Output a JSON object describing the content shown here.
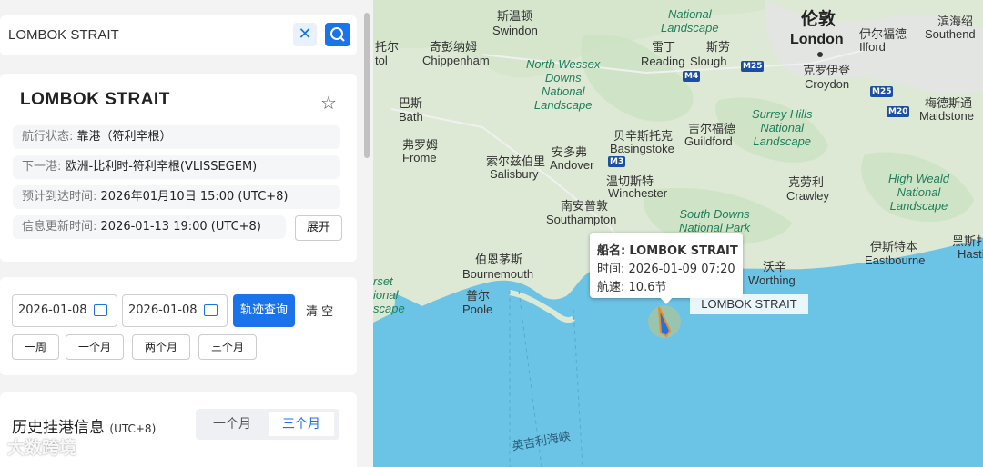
{
  "search": {
    "query": "LOMBOK STRAIT",
    "clear_icon": "close-icon",
    "search_icon": "search-icon"
  },
  "ship": {
    "name": "LOMBOK STRAIT",
    "status_label": "航行状态:",
    "status_value": "靠港（符利辛根）",
    "next_port_label": "下一港:",
    "next_port_value": "欧洲-比利时-符利辛根(VLISSEGEM)",
    "eta_label": "预计到达时间:",
    "eta_value": "2026年01月10日 15:00 (UTC+8)",
    "updated_label": "信息更新时间:",
    "updated_value": "2026-01-13 19:00 (UTC+8)",
    "expand_label": "展开"
  },
  "track": {
    "start_date": "2026-01-08",
    "end_date": "2026-01-08",
    "query_label": "轨迹查询",
    "clear_label": "清 空",
    "quick": [
      "一周",
      "一个月",
      "两个月",
      "三个月"
    ]
  },
  "history": {
    "title": "历史挂港信息",
    "tz": "(UTC+8)",
    "tab_one_month": "一个月",
    "tab_three_months": "三个月"
  },
  "watermark": "大数跨境",
  "map": {
    "labels": {
      "swindon_cn": "斯温顿",
      "swindon": "Swindon",
      "chippenham_cn": "奇彭纳姆",
      "chippenham": "Chippenham",
      "tuoer_cn": "托尔",
      "tol": "tol",
      "bath_cn": "巴斯",
      "bath": "Bath",
      "frome_cn": "弗罗姆",
      "frome": "Frome",
      "reading_cn": "雷丁",
      "reading": "Reading",
      "slough_cn": "斯劳",
      "slough": "Slough",
      "london_cn": "伦敦",
      "london": "London",
      "ilford_cn": "伊尔福德",
      "ilford": "Ilford",
      "southend_cn": "滨海绍",
      "southend": "Southend-",
      "croydon_cn": "克罗伊登",
      "croydon": "Croydon",
      "basingstoke_cn": "贝辛斯托克",
      "basingstoke": "Basingstoke",
      "guildford_cn": "吉尔福德",
      "guildford": "Guildford",
      "andover_cn": "安多弗",
      "andover": "Andover",
      "salisbury_cn": "索尔兹伯里",
      "salisbury": "Salisbury",
      "winchester_cn": "温切斯特",
      "winchester": "Winchester",
      "southampton_cn": "南安普敦",
      "southampton": "Southampton",
      "crawley_cn": "克劳利",
      "crawley": "Crawley",
      "maidstone_cn": "梅德斯通",
      "maidstone": "Maidstone",
      "bournemouth_cn": "伯恩茅斯",
      "bournemouth": "Bournemouth",
      "poole_cn": "普尔",
      "poole": "Poole",
      "worthing_cn": "沃辛",
      "worthing": "Worthing",
      "eastbourne_cn": "伊斯特本",
      "eastbourne": "Eastbourne",
      "hastings_cn": "黑斯扌",
      "hastings": "Hasti",
      "channel_cn": "英吉利海峡",
      "nw_landscape": "North Wessex\nDowns\nNational\nLandscape",
      "chilterns": "National\nLandscape",
      "surrey_hills": "Surrey Hills\nNational\nLandscape",
      "high_weald": "High Weald\nNational\nLandscape",
      "south_downs": "South Downs\nNational Park",
      "rset": "rset\nional\nscape",
      "m4": "M4",
      "m25a": "M25",
      "m25b": "M25",
      "m20": "M20",
      "m3": "M3"
    },
    "tooltip": {
      "name_label": "船名:",
      "name_value": "LOMBOK STRAIT",
      "time_label": "时间:",
      "time_value": "2026-01-09 07:20",
      "speed_label": "航速:",
      "speed_value": "10.6节"
    },
    "ship_label": "LOMBOK STRAIT",
    "colors": {
      "sea": "#6bc3e6",
      "land": "#dbe9d4",
      "ship": "#1a73e8"
    }
  }
}
